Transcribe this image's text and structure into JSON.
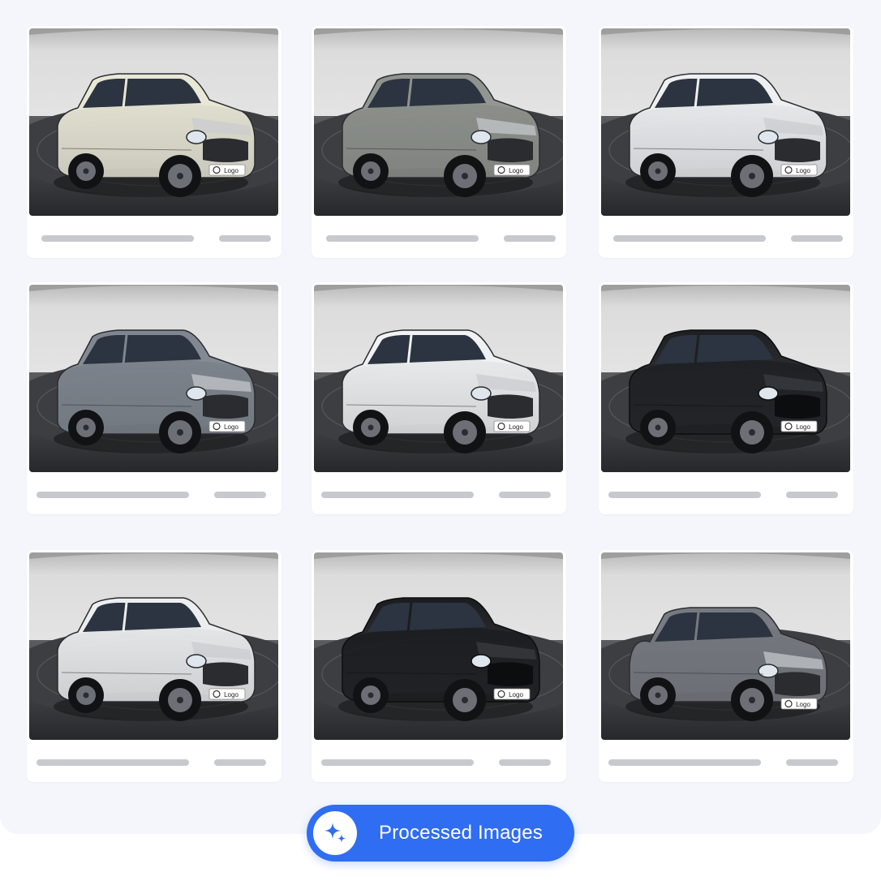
{
  "gallery": {
    "cards": [
      {
        "vehicle_icon": "hatchback-car-icon",
        "body_color": "#e9e7d6",
        "plate_text": "Logo"
      },
      {
        "vehicle_icon": "crossover-car-icon",
        "body_color": "#8f938d",
        "plate_text": "Logo"
      },
      {
        "vehicle_icon": "suv-car-icon",
        "body_color": "#eef0f2",
        "plate_text": "Logo"
      },
      {
        "vehicle_icon": "convertible-car-icon",
        "body_color": "#7f868f",
        "plate_text": "Logo"
      },
      {
        "vehicle_icon": "suv-car-icon",
        "body_color": "#f1f2f3",
        "plate_text": "Logo"
      },
      {
        "vehicle_icon": "suv-car-icon",
        "body_color": "#1d1f22",
        "plate_text": "Logo"
      },
      {
        "vehicle_icon": "suv-car-icon",
        "body_color": "#eceeef",
        "plate_text": "Logo"
      },
      {
        "vehicle_icon": "suv-car-icon",
        "body_color": "#1b1c1f",
        "plate_text": "Logo"
      },
      {
        "vehicle_icon": "sedan-car-icon",
        "body_color": "#767a80",
        "plate_text": "Logo"
      }
    ]
  },
  "cta": {
    "icon": "sparkles-icon",
    "label": "Processed Images",
    "color": "#2f6ef2"
  }
}
